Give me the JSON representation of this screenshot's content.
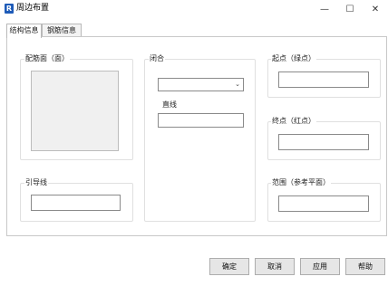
{
  "window": {
    "icon_letter": "R",
    "title": "周边布置",
    "minimize": "—",
    "maximize": "☐",
    "close": "✕"
  },
  "tabs": [
    {
      "label": "结构信息",
      "active": true
    },
    {
      "label": "钢筋信息",
      "active": false
    }
  ],
  "groups": {
    "profile": {
      "label": "配筋面（面）"
    },
    "guide": {
      "label": "引导线",
      "value": ""
    },
    "closure": {
      "label": "闭合",
      "selected": "",
      "straight_label": "直线",
      "straight_value": ""
    },
    "start": {
      "label": "起点（绿点）",
      "value": ""
    },
    "end": {
      "label": "终点（红点）",
      "value": ""
    },
    "range": {
      "label": "范围（参考平面）",
      "value": ""
    }
  },
  "buttons": {
    "ok": "确定",
    "cancel": "取消",
    "apply": "应用",
    "help": "帮助"
  }
}
